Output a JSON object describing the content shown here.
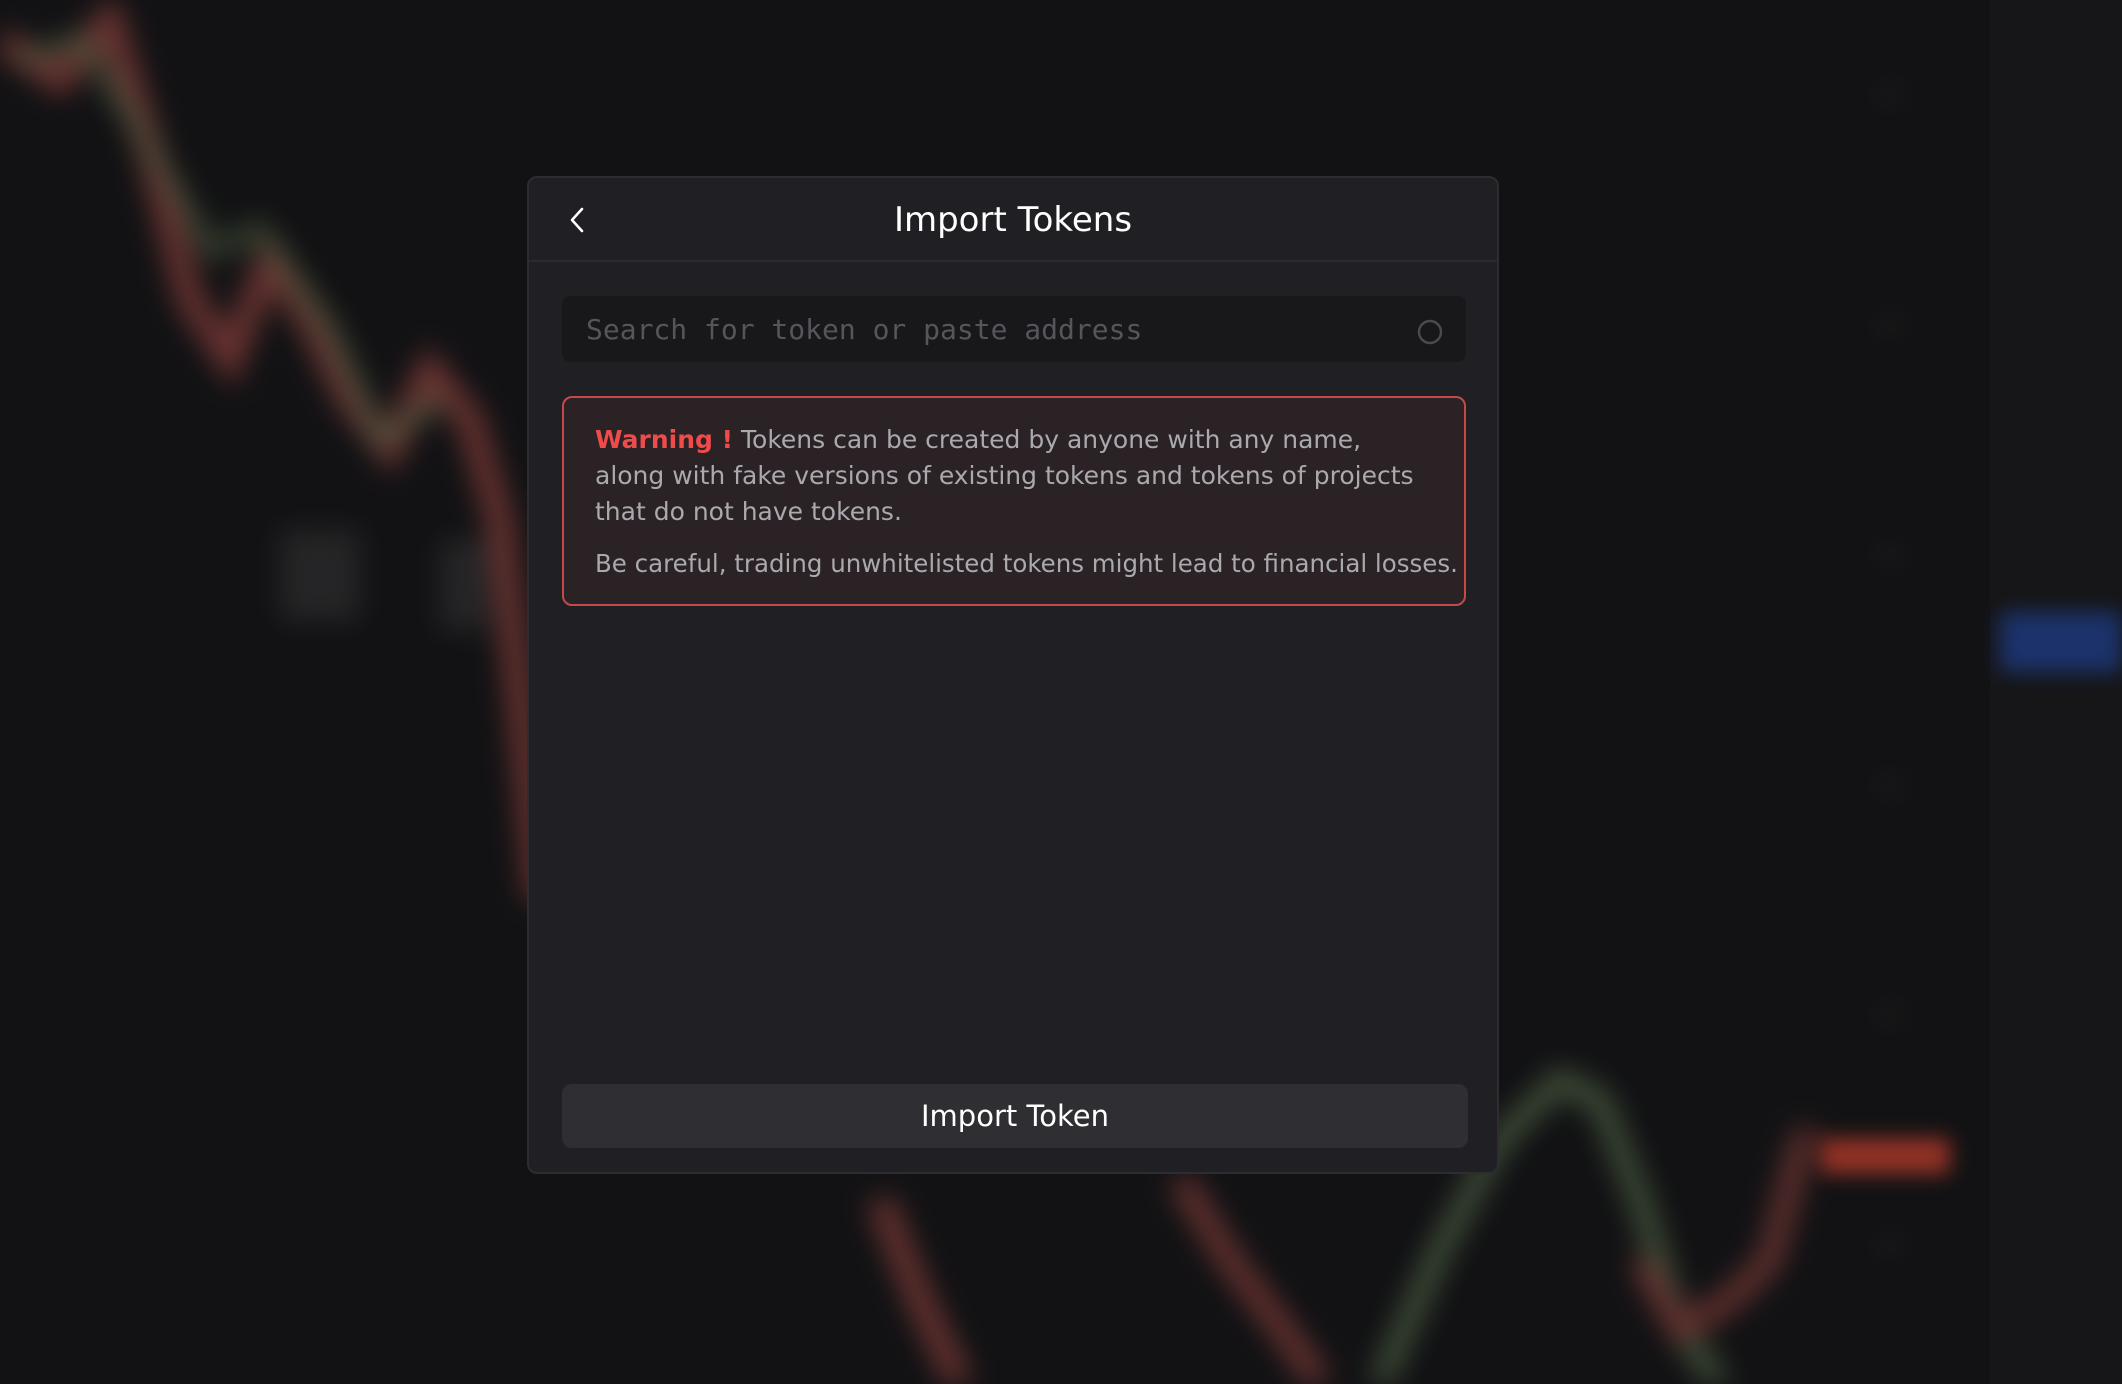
{
  "modal": {
    "title": "Import Tokens",
    "back_icon": "chevron-left-icon"
  },
  "search": {
    "placeholder": "Search for token or paste address",
    "value": "",
    "icon": "search-icon"
  },
  "warning": {
    "label": "Warning !",
    "message": " Tokens can be created by anyone with any name, along with fake versions of existing tokens and tokens of projects that do not have tokens.",
    "caution": "Be careful, trading unwhitelisted tokens might lead to financial losses."
  },
  "actions": {
    "import_label": "Import Token"
  },
  "colors": {
    "modal_bg": "#202024",
    "warning_accent": "#ef4b4b",
    "warning_border": "#c44a4a",
    "button_bg": "#2f2f33"
  }
}
